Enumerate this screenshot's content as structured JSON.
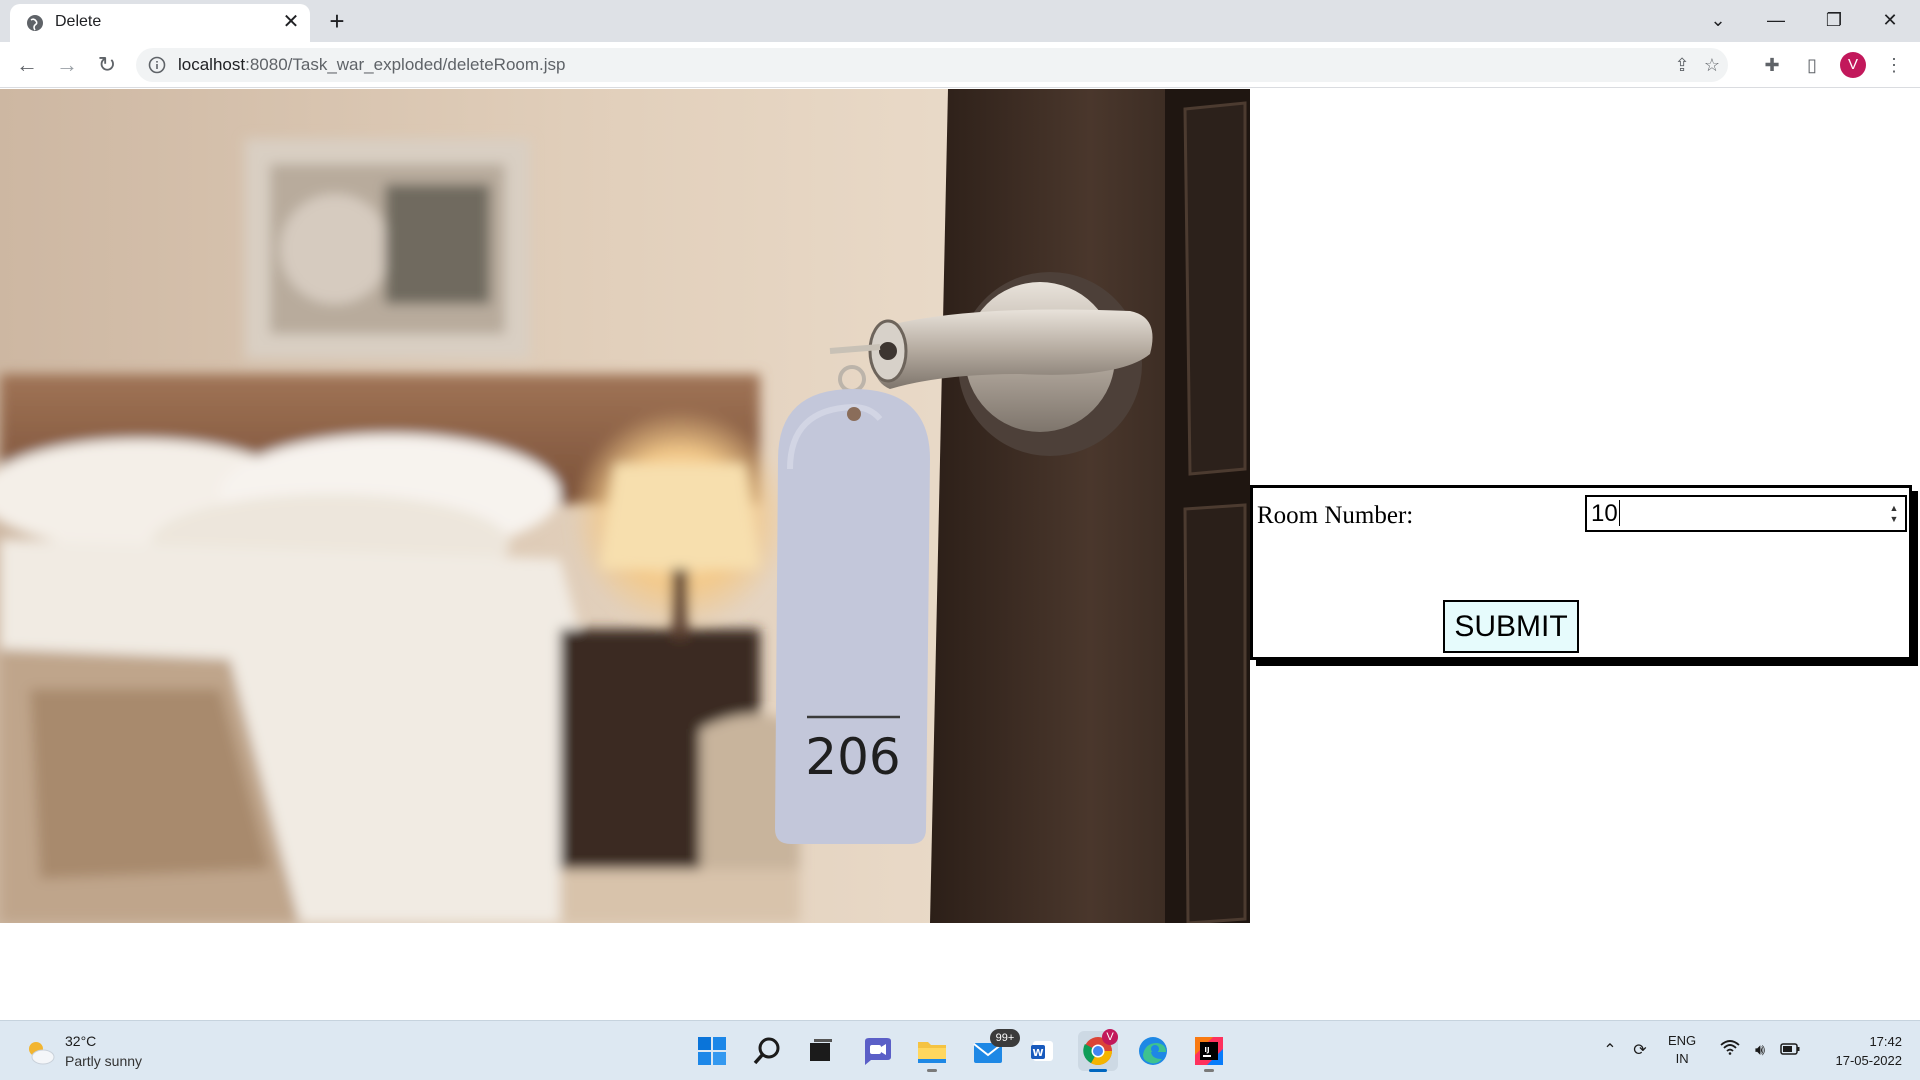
{
  "browser": {
    "tab_title": "Delete",
    "tab_close": "✕",
    "new_tab": "+",
    "url_host": "localhost",
    "url_path": ":8080/Task_war_exploded/deleteRoom.jsp",
    "profile_initial": "V",
    "icons": [
      "back-icon",
      "forward-icon",
      "reload-icon",
      "info-icon",
      "share-icon",
      "star-icon",
      "extensions-icon",
      "sidepanel-icon",
      "menu-icon"
    ]
  },
  "page": {
    "hero_tag_number": "206",
    "form": {
      "room_label": "Room Number:",
      "room_value": "10",
      "submit_label": "SUBMIT"
    }
  },
  "taskbar": {
    "weather_temp": "32°C",
    "weather_desc": "Partly sunny",
    "mail_badge": "99+",
    "chrome_badge": "V",
    "lang_top": "ENG",
    "lang_bottom": "IN",
    "time": "17:42",
    "date": "17-05-2022",
    "apps": [
      "start",
      "search",
      "task-view",
      "teams-chat",
      "file-explorer",
      "mail",
      "word",
      "chrome",
      "edge",
      "intellij"
    ]
  },
  "colors": {
    "form_border": "#000000",
    "submit_bg": "#e6fbfc",
    "taskbar_bg": "#dde8f2",
    "avatar_bg": "#c2185b"
  }
}
